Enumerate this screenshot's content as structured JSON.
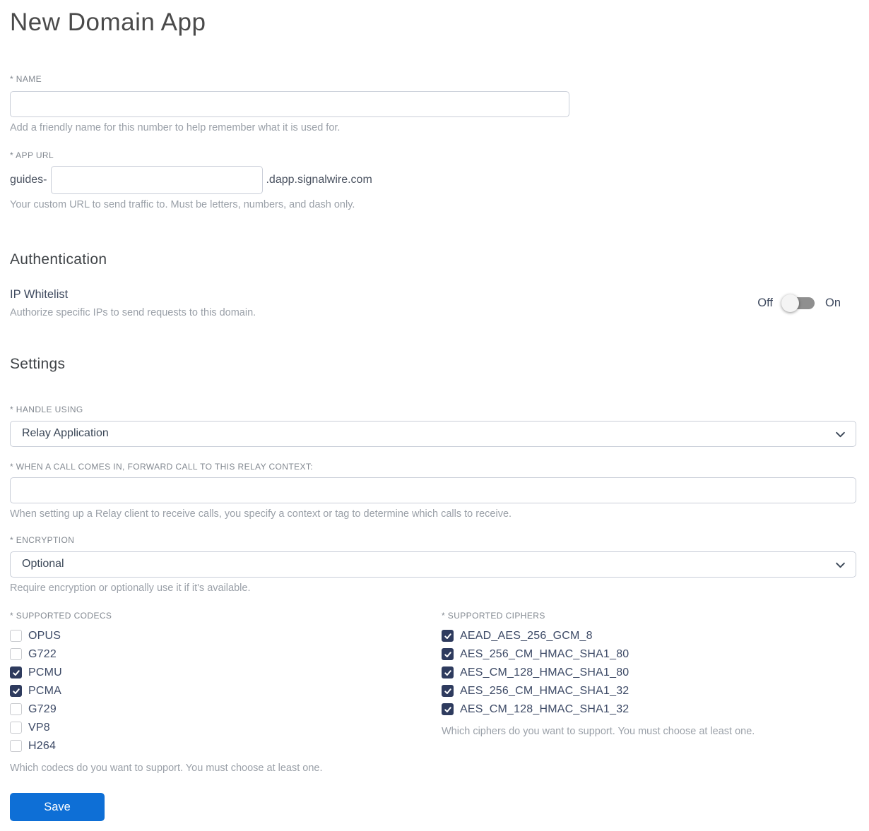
{
  "page": {
    "title": "New Domain App"
  },
  "colors": {
    "accent_blue": "#0e6fd6",
    "checkbox_checked": "#2e3b5e",
    "input_border": "#c9ced8",
    "helper_gray": "#9aa0a8",
    "label_gray": "#828890",
    "toggle_track": "#8f8f8f"
  },
  "name_field": {
    "label": "* NAME",
    "value": "",
    "helper": "Add a friendly name for this number to help remember what it is used for."
  },
  "app_url_field": {
    "label": "* APP URL",
    "prefix": "guides-",
    "value": "",
    "suffix": ".dapp.signalwire.com",
    "helper": "Your custom URL to send traffic to. Must be letters, numbers, and dash only."
  },
  "authentication": {
    "heading": "Authentication",
    "ip_whitelist": {
      "label": "IP Whitelist",
      "helper": "Authorize specific IPs to send requests to this domain.",
      "off_label": "Off",
      "on_label": "On",
      "state": "off"
    }
  },
  "settings": {
    "heading": "Settings",
    "handle_using": {
      "label": "* HANDLE USING",
      "value": "Relay Application"
    },
    "relay_context": {
      "label": "* WHEN A CALL COMES IN, FORWARD CALL TO THIS RELAY CONTEXT:",
      "value": "",
      "helper": "When setting up a Relay client to receive calls, you specify a context or tag to determine which calls to receive."
    },
    "encryption": {
      "label": "* ENCRYPTION",
      "value": "Optional",
      "helper": "Require encryption or optionally use it if it's available."
    },
    "codecs": {
      "label": "* SUPPORTED CODECS",
      "helper": "Which codecs do you want to support. You must choose at least one.",
      "options": [
        {
          "label": "OPUS",
          "checked": false
        },
        {
          "label": "G722",
          "checked": false
        },
        {
          "label": "PCMU",
          "checked": true
        },
        {
          "label": "PCMA",
          "checked": true
        },
        {
          "label": "G729",
          "checked": false
        },
        {
          "label": "VP8",
          "checked": false
        },
        {
          "label": "H264",
          "checked": false
        }
      ]
    },
    "ciphers": {
      "label": "* SUPPORTED CIPHERS",
      "helper": "Which ciphers do you want to support. You must choose at least one.",
      "options": [
        {
          "label": "AEAD_AES_256_GCM_8",
          "checked": true
        },
        {
          "label": "AES_256_CM_HMAC_SHA1_80",
          "checked": true
        },
        {
          "label": "AES_CM_128_HMAC_SHA1_80",
          "checked": true
        },
        {
          "label": "AES_256_CM_HMAC_SHA1_32",
          "checked": true
        },
        {
          "label": "AES_CM_128_HMAC_SHA1_32",
          "checked": true
        }
      ]
    }
  },
  "save_button": {
    "label": "Save"
  }
}
